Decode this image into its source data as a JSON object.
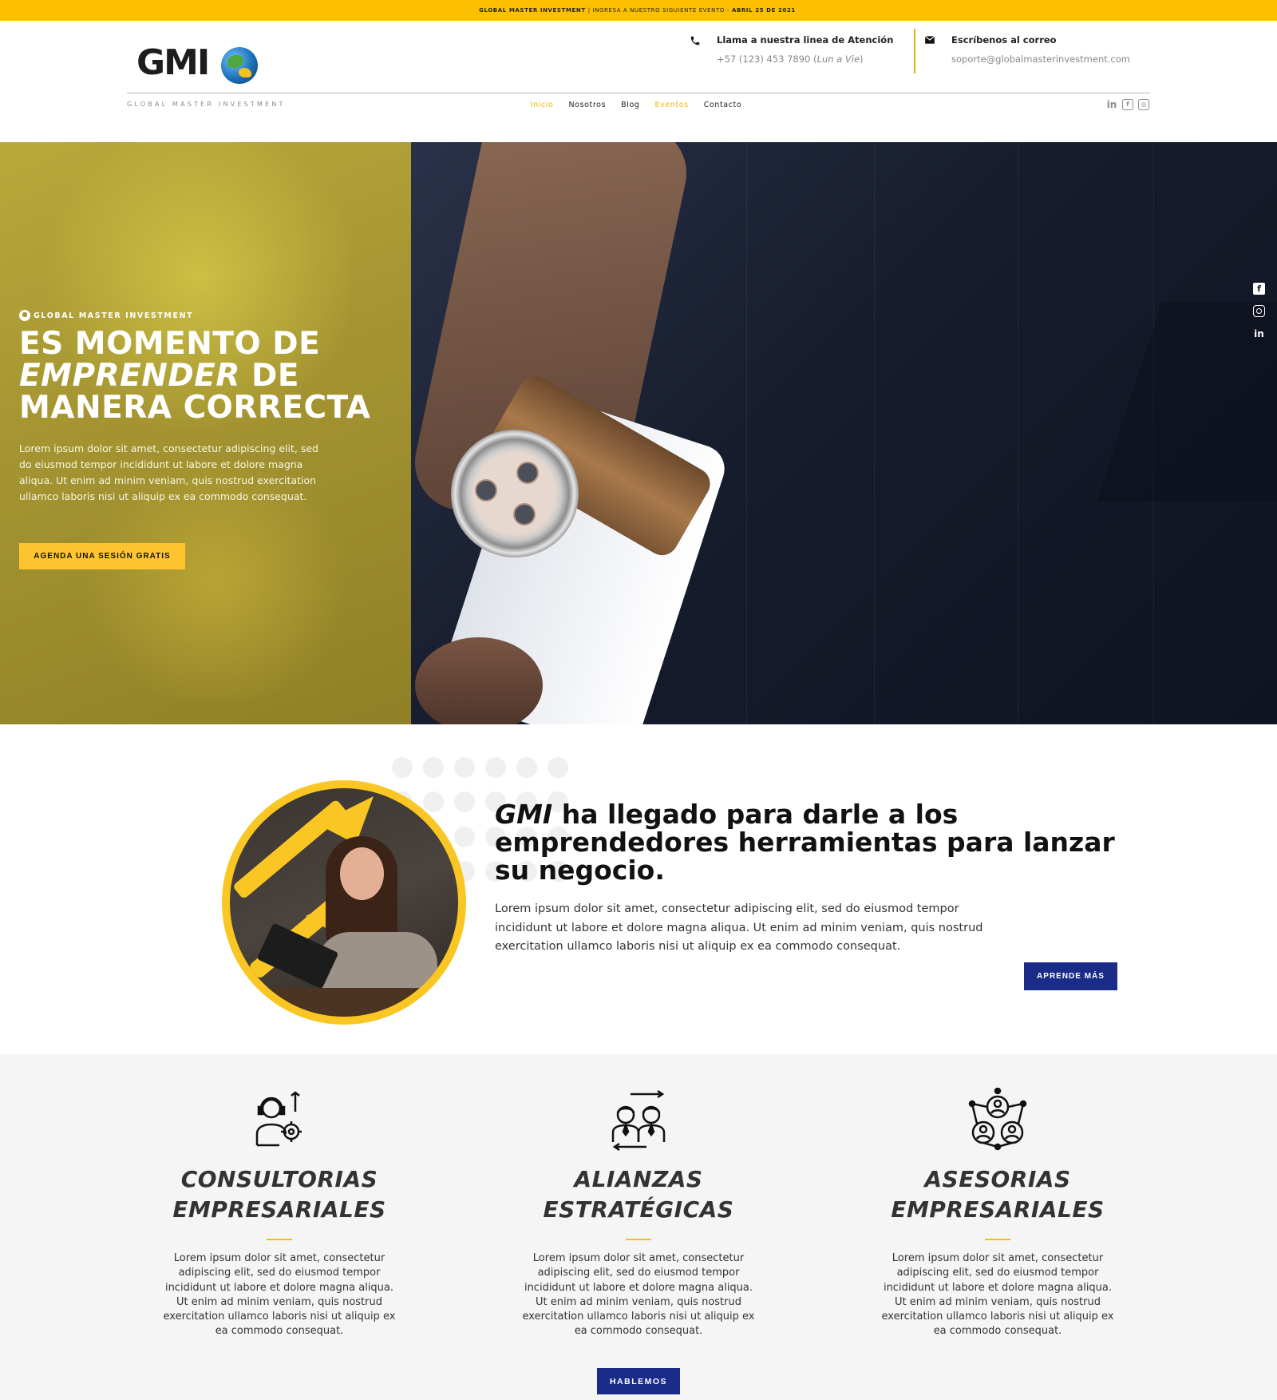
{
  "topbar": {
    "brand": "GLOBAL MASTER INVESTMENT",
    "message": "| INGRESA A NUESTRO SIGUIENTE EVENTO -",
    "date": "ABRIL 25 DE 2021"
  },
  "header": {
    "logo_text": "GMI",
    "logo_sub": "GLOBAL MASTER INVESTMENT",
    "phone": {
      "title": "Llama a nuestra linea de Atención",
      "number": "+57 (123) 453 7890",
      "hours": "Lun a Vie"
    },
    "mail": {
      "title": "Escríbenos al correo",
      "address": "soporte@globalmasterinvestment.com"
    },
    "nav": [
      "Inicio",
      "Nosotros",
      "Blog",
      "Eventos",
      "Contacto"
    ],
    "nav_active_color": "#f3b700"
  },
  "hero": {
    "eyebrow": "GLOBAL MASTER INVESTMENT",
    "title_line1": "ES MOMENTO DE",
    "title_italic": "EMPRENDER",
    "title_line2": " DE",
    "title_line3": "MANERA CORRECTA",
    "text": "Lorem ipsum dolor sit amet, consectetur adipiscing elit, sed do eiusmod tempor incididunt ut labore et dolore magna aliqua. Ut enim ad minim veniam, quis nostrud exercitation ullamco laboris nisi ut aliquip ex ea commodo consequat.",
    "cta": "AGENDA UNA SESIÓN GRATIS"
  },
  "about": {
    "title_italic": "GMI",
    "title_rest": " ha llegado para darle a los emprendedores herramientas para lanzar su negocio.",
    "text": "Lorem ipsum dolor sit amet, consectetur adipiscing elit, sed do eiusmod tempor incididunt ut labore et dolore magna aliqua. Ut enim ad minim veniam, quis nostrud exercitation ullamco laboris nisi ut aliquip ex ea commodo consequat.",
    "cta": "APRENDE MÁS"
  },
  "services": [
    {
      "icon": "consultant-gear-icon",
      "title_line1": "CONSULTORIAS",
      "title_line2": "EMPRESARIALES",
      "text": "Lorem ipsum dolor sit amet, consectetur adipiscing elit, sed do eiusmod tempor incididunt ut labore et dolore magna aliqua. Ut enim ad minim veniam, quis nostrud exercitation ullamco laboris nisi ut aliquip ex ea commodo consequat."
    },
    {
      "icon": "partners-exchange-icon",
      "title_line1": "ALIANZAS",
      "title_line2": "ESTRATÉGICAS",
      "text": "Lorem ipsum dolor sit amet, consectetur adipiscing elit, sed do eiusmod tempor incididunt ut labore et dolore magna aliqua. Ut enim ad minim veniam, quis nostrud exercitation ullamco laboris nisi ut aliquip ex ea commodo consequat."
    },
    {
      "icon": "network-people-icon",
      "title_line1": "ASESORIAS",
      "title_line2": "EMPRESARIALES",
      "text": "Lorem ipsum dolor sit amet, consectetur adipiscing elit, sed do eiusmod tempor incididunt ut labore et dolore magna aliqua. Ut enim ad minim veniam, quis nostrud exercitation ullamco laboris nisi ut aliquip ex ea commodo consequat."
    }
  ],
  "services_cta": "HABLEMOS",
  "colors": {
    "accent_yellow": "#fdc000",
    "brand_blue": "#1a2c88"
  }
}
